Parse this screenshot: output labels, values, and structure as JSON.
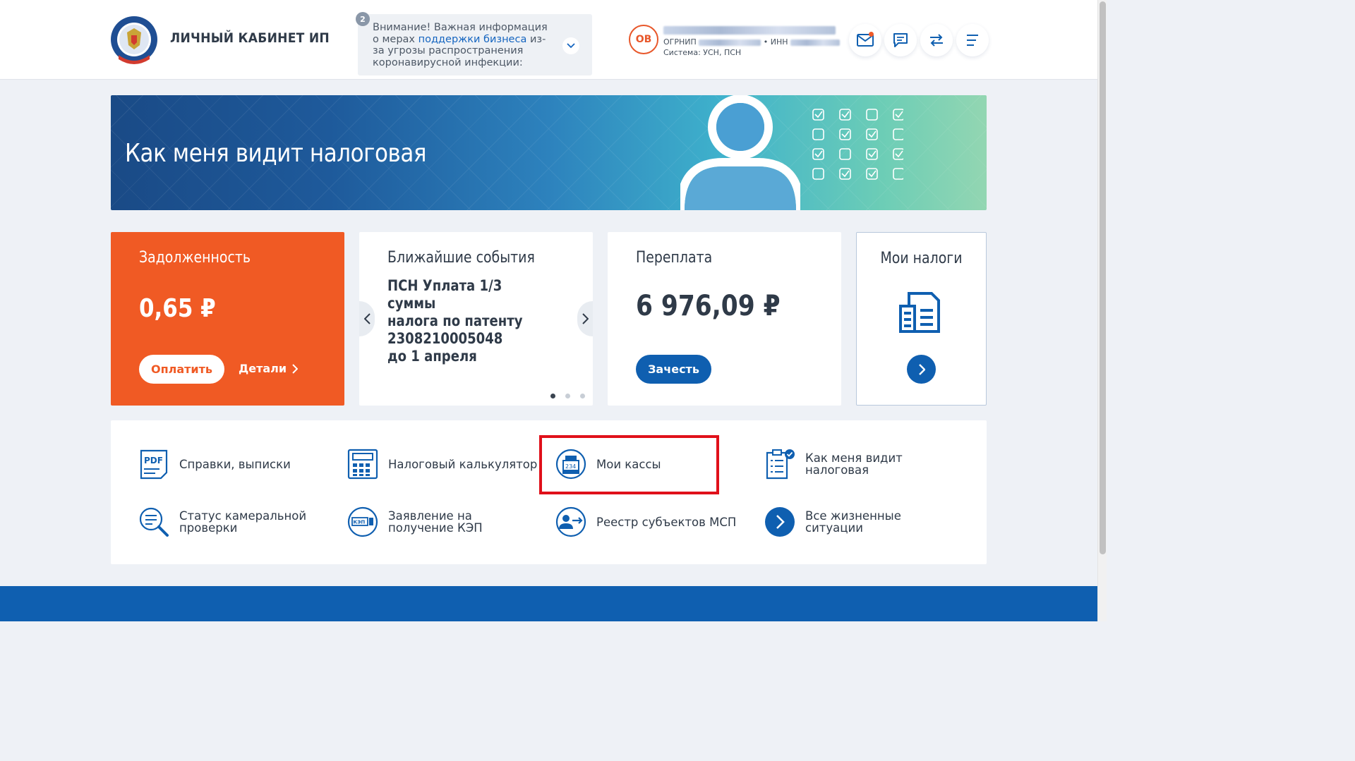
{
  "header": {
    "app_title": "ЛИЧНЫЙ КАБИНЕТ ИП",
    "notice": {
      "badge": "2",
      "text_before": "Внимание! Важная информация о мерах ",
      "link_text": "поддержки бизнеса",
      "text_after": " из-за угрозы распространения коронавирусной инфекции:"
    },
    "user": {
      "initials": "ОВ",
      "ogrnip_label": "ОГРНИП",
      "inn_label": "• ИНН",
      "system_text": "Система: УСН, ПСН"
    }
  },
  "banner": {
    "title": "Как меня видит налоговая"
  },
  "cards": {
    "debt": {
      "title": "Задолженность",
      "amount": "0,65 ₽",
      "pay_label": "Оплатить",
      "details_label": "Детали"
    },
    "events": {
      "title": "Ближайшие события",
      "lines": [
        "ПСН Уплата 1/3 суммы",
        "налога по патенту",
        "2308210005048",
        "до 1 апреля"
      ],
      "pages": 3,
      "active_page": 1
    },
    "overpay": {
      "title": "Переплата",
      "amount": "6 976,09 ₽",
      "offset_label": "Зачесть"
    },
    "taxes": {
      "title": "Мои налоги"
    }
  },
  "quick_links": [
    {
      "label": "Справки, выписки",
      "icon": "pdf-document-icon"
    },
    {
      "label": "Налоговый калькулятор",
      "icon": "calculator-icon"
    },
    {
      "label": "Мои кассы",
      "icon": "cash-register-icon"
    },
    {
      "label": "Как меня видит налоговая",
      "icon": "checklist-icon"
    },
    {
      "label": "Статус камеральной проверки",
      "icon": "document-search-icon"
    },
    {
      "label": "Заявление на получение КЭП",
      "icon": "signature-key-icon"
    },
    {
      "label": "Реестр субъектов МСП",
      "icon": "registry-icon"
    },
    {
      "label": "Все жизненные ситуации",
      "icon": "arrow-right-circle-icon"
    }
  ],
  "colors": {
    "brand_blue": "#0f5fb0",
    "accent_orange": "#f05a24",
    "highlight_red": "#e0101a"
  }
}
